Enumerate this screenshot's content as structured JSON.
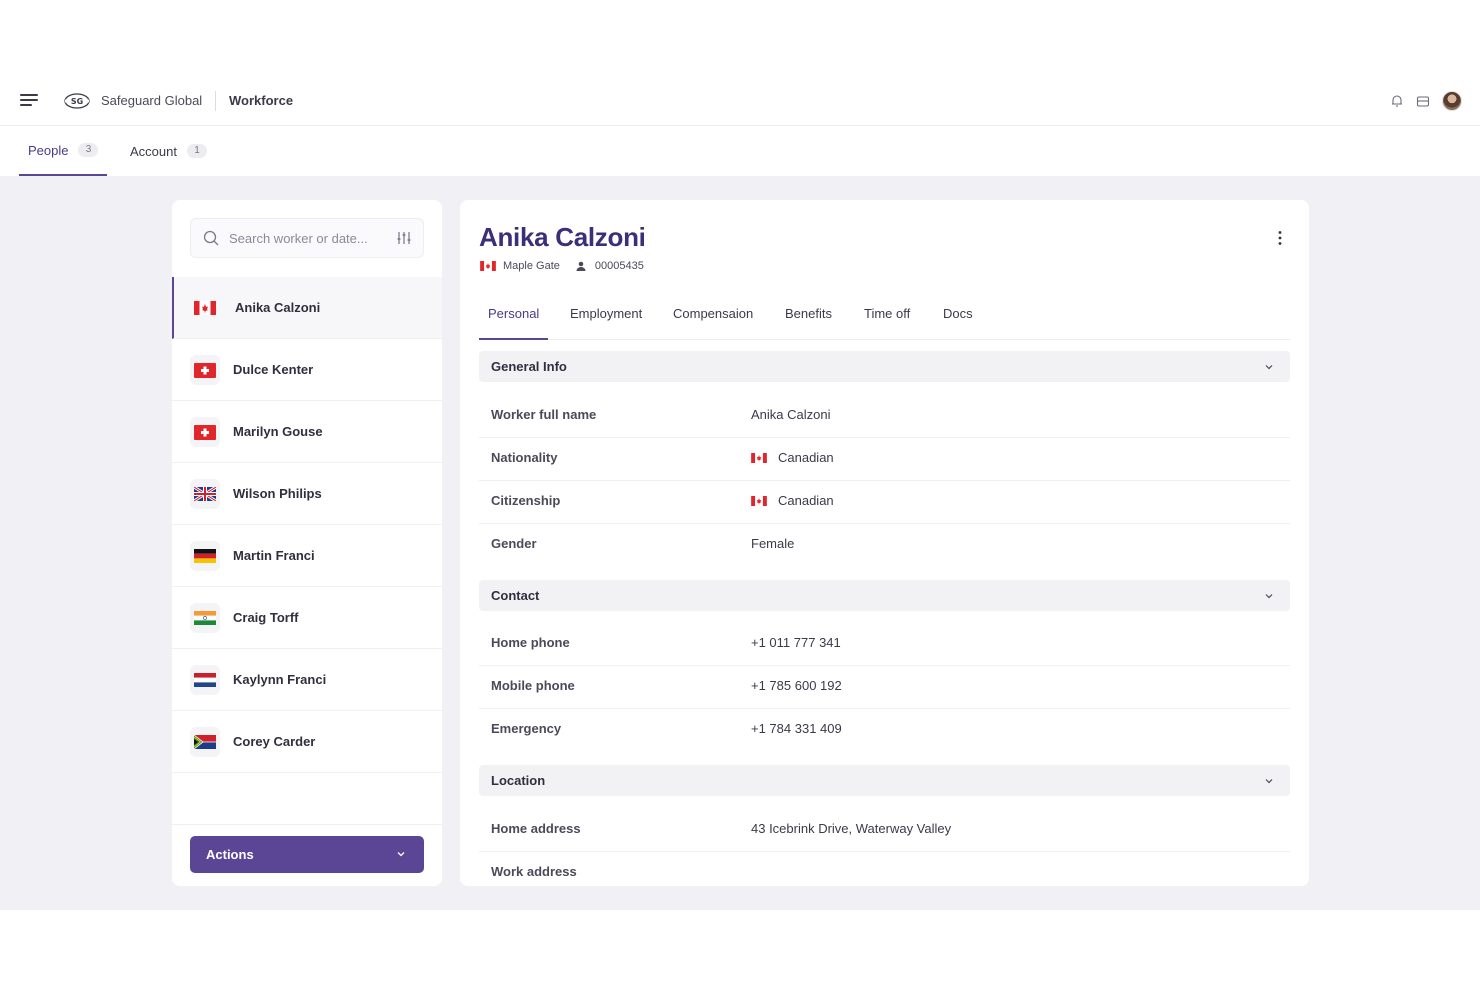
{
  "header": {
    "brand": "Safeguard Global",
    "product": "Workforce"
  },
  "top_tabs": [
    {
      "label": "People",
      "count": "3",
      "active": true
    },
    {
      "label": "Account",
      "count": "1",
      "active": false
    }
  ],
  "search": {
    "placeholder": "Search worker or date..."
  },
  "workers": [
    {
      "name": "Anika Calzoni",
      "flag": "canada-flag-icon",
      "selected": true
    },
    {
      "name": "Dulce Kenter",
      "flag": "switzerland-flag-icon",
      "selected": false
    },
    {
      "name": "Marilyn Gouse",
      "flag": "switzerland-flag-icon",
      "selected": false
    },
    {
      "name": "Wilson Philips",
      "flag": "uk-flag-icon",
      "selected": false
    },
    {
      "name": "Martin Franci",
      "flag": "germany-flag-icon",
      "selected": false
    },
    {
      "name": "Craig Torff",
      "flag": "india-flag-icon",
      "selected": false
    },
    {
      "name": "Kaylynn Franci",
      "flag": "netherlands-flag-icon",
      "selected": false
    },
    {
      "name": "Corey Carder",
      "flag": "south-africa-flag-icon",
      "selected": false
    }
  ],
  "actions_label": "Actions",
  "detail": {
    "name": "Anika Calzoni",
    "location": "Maple Gate",
    "worker_id": "00005435",
    "tabs": [
      "Personal",
      "Employment",
      "Compensaion",
      "Benefits",
      "Time off",
      "Docs"
    ],
    "active_tab": "Personal",
    "sections": {
      "general": {
        "title": "General Info",
        "fields": [
          {
            "label": "Worker full name",
            "value": "Anika Calzoni"
          },
          {
            "label": "Nationality",
            "value": "Canadian"
          },
          {
            "label": "Citizenship",
            "value": "Canadian"
          },
          {
            "label": "Gender",
            "value": "Female"
          }
        ]
      },
      "contact": {
        "title": "Contact",
        "fields": [
          {
            "label": "Home phone",
            "value": "+1 011 777 341"
          },
          {
            "label": "Mobile phone",
            "value": "+1 785 600 192"
          },
          {
            "label": "Emergency",
            "value": "+1 784 331 409"
          }
        ]
      },
      "location": {
        "title": "Location",
        "fields": [
          {
            "label": "Home address",
            "value": "43 Icebrink Drive, Waterway Valley"
          },
          {
            "label": "Work address",
            "value": ""
          }
        ]
      }
    }
  },
  "colors": {
    "accent": "#5b4595",
    "title": "#3b2f7a",
    "canvas": "#f1f1f5"
  }
}
